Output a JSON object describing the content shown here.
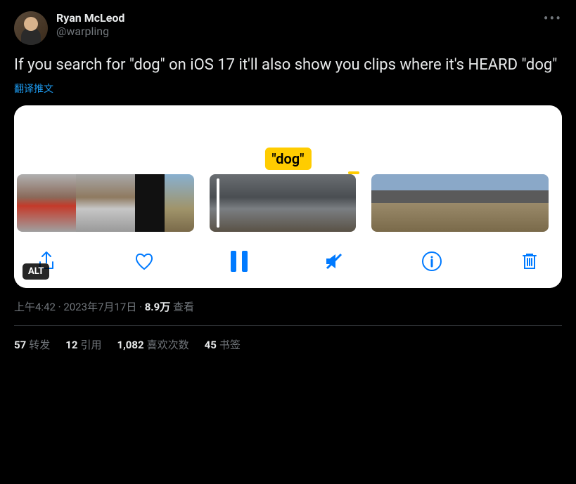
{
  "author": {
    "display_name": "Ryan McLeod",
    "handle": "@warpling"
  },
  "tweet": {
    "text": "If you search for \"dog\" on iOS 17 it'll also show you clips where it's HEARD \"dog\"",
    "translate_label": "翻译推文"
  },
  "media": {
    "dog_badge": "\"dog\"",
    "alt_label": "ALT"
  },
  "meta": {
    "time": "上午4:42",
    "date": "2023年7月17日",
    "views_count": "8.9万",
    "views_label": "查看"
  },
  "stats": {
    "retweets_count": "57",
    "retweets_label": "转发",
    "quotes_count": "12",
    "quotes_label": "引用",
    "likes_count": "1,082",
    "likes_label": "喜欢次数",
    "bookmarks_count": "45",
    "bookmarks_label": "书签"
  }
}
